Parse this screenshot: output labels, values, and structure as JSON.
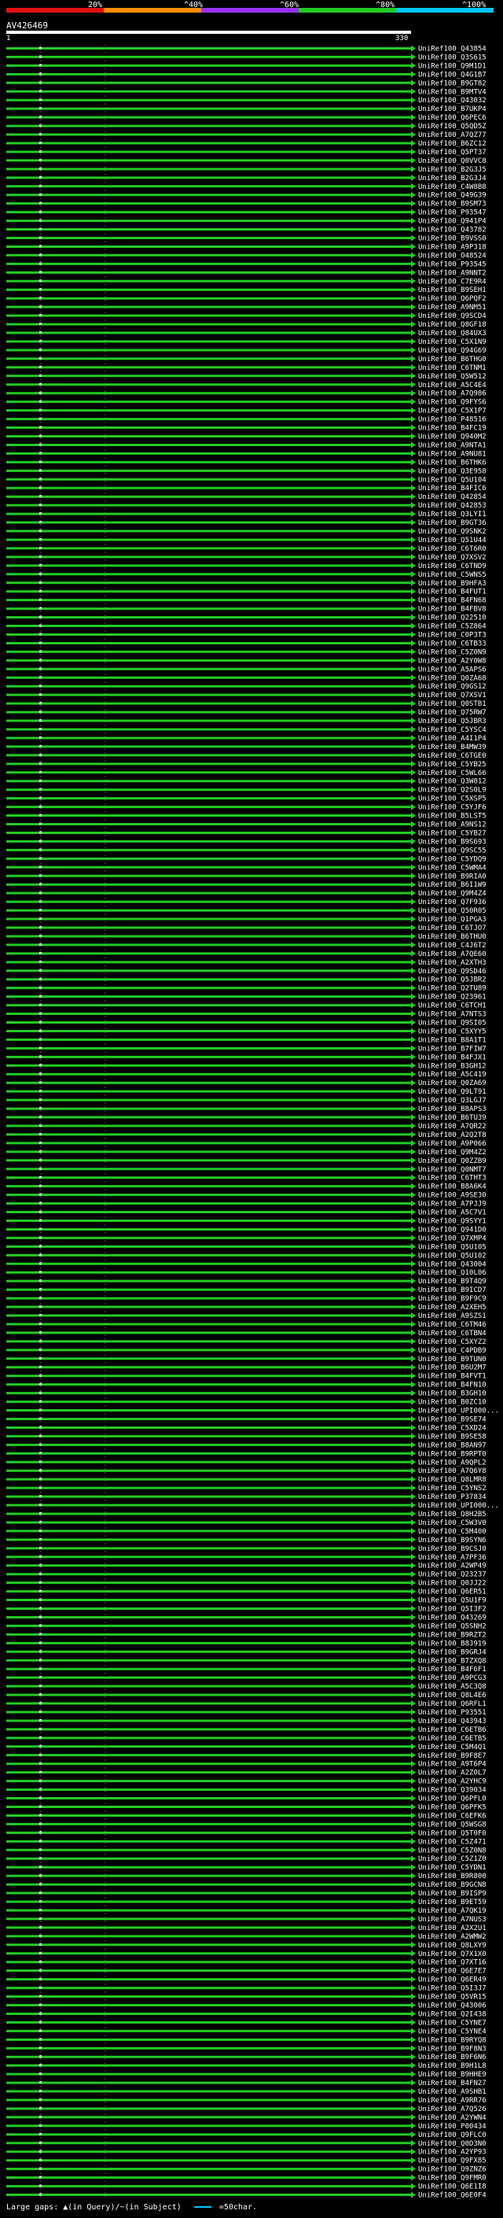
{
  "legend": {
    "ticks": [
      "20%",
      "^40%",
      "^60%",
      "^80%",
      "^100%"
    ],
    "colors": [
      "#e01010",
      "#ff8c00",
      "#9b30ff",
      "#22cc22",
      "#00c8ff"
    ]
  },
  "query": {
    "name": "AV426469",
    "start": "1",
    "end": "330"
  },
  "hits": [
    {
      "label": "UniRef100_Q43854",
      "color": "#22cc22"
    },
    {
      "label": "UniRef100_Q3S615",
      "color": "#22cc22"
    },
    {
      "label": "UniRef100_Q9M1D1",
      "color": "#22cc22"
    },
    {
      "label": "UniRef100_Q4G1B7",
      "color": "#22cc22"
    },
    {
      "label": "UniRef100_B9GT82",
      "color": "#22cc22"
    },
    {
      "label": "UniRef100_B9MTV4",
      "color": "#22cc22"
    },
    {
      "label": "UniRef100_Q43032",
      "color": "#22cc22"
    },
    {
      "label": "UniRef100_B7UKP4",
      "color": "#22cc22"
    },
    {
      "label": "UniRef100_Q6PEC6",
      "color": "#22cc22"
    },
    {
      "label": "UniRef100_Q5QD5Z",
      "color": "#22cc22"
    },
    {
      "label": "UniRef100_A7QZ77",
      "color": "#22cc22"
    },
    {
      "label": "UniRef100_B6ZC12",
      "color": "#22cc22"
    },
    {
      "label": "UniRef100_Q5PT37",
      "color": "#22cc22"
    },
    {
      "label": "UniRef100_Q0VVC8",
      "color": "#22cc22"
    },
    {
      "label": "UniRef100_B2G3J5",
      "color": "#22cc22"
    },
    {
      "label": "UniRef100_B2G3J4",
      "color": "#22cc22"
    },
    {
      "label": "UniRef100_C4W8B8",
      "color": "#22cc22"
    },
    {
      "label": "UniRef100_Q49G39",
      "color": "#22cc22"
    },
    {
      "label": "UniRef100_B9SM73",
      "color": "#22cc22"
    },
    {
      "label": "UniRef100_P93547",
      "color": "#22cc22"
    },
    {
      "label": "UniRef100_Q941P4",
      "color": "#22cc22"
    },
    {
      "label": "UniRef100_Q43782",
      "color": "#22cc22"
    },
    {
      "label": "UniRef100_B9VSS0",
      "color": "#22cc22"
    },
    {
      "label": "UniRef100_A9P318",
      "color": "#22cc22"
    },
    {
      "label": "UniRef100_O48524",
      "color": "#22cc22"
    },
    {
      "label": "UniRef100_P93545",
      "color": "#22cc22"
    },
    {
      "label": "UniRef100_A9NNT2",
      "color": "#22cc22"
    },
    {
      "label": "UniRef100_C7E9R4",
      "color": "#22cc22"
    },
    {
      "label": "UniRef100_B9SEH1",
      "color": "#22cc22"
    },
    {
      "label": "UniRef100_Q6PQF2",
      "color": "#22cc22"
    },
    {
      "label": "UniRef100_A9NM51",
      "color": "#22cc22"
    },
    {
      "label": "UniRef100_Q9SCD4",
      "color": "#22cc22"
    },
    {
      "label": "UniRef100_Q8GF18",
      "color": "#22cc22"
    },
    {
      "label": "UniRef100_Q84UX3",
      "color": "#22cc22"
    },
    {
      "label": "UniRef100_C5X1N9",
      "color": "#22cc22"
    },
    {
      "label": "UniRef100_Q94G69",
      "color": "#22cc22"
    },
    {
      "label": "UniRef100_B6THG0",
      "color": "#22cc22"
    },
    {
      "label": "UniRef100_C6TNM1",
      "color": "#22cc22"
    },
    {
      "label": "UniRef100_Q5W512",
      "color": "#22cc22"
    },
    {
      "label": "UniRef100_A5C4E4",
      "color": "#22cc22"
    },
    {
      "label": "UniRef100_A7Q986",
      "color": "#22cc22"
    },
    {
      "label": "UniRef100_Q9FYS6",
      "color": "#22cc22"
    },
    {
      "label": "UniRef100_C5X1P7",
      "color": "#22cc22"
    },
    {
      "label": "UniRef100_P48516",
      "color": "#22cc22"
    },
    {
      "label": "UniRef100_B4FC19",
      "color": "#22cc22"
    },
    {
      "label": "UniRef100_Q940M2",
      "color": "#22cc22"
    },
    {
      "label": "UniRef100_A9NTA1",
      "color": "#22cc22"
    },
    {
      "label": "UniRef100_A9NU81",
      "color": "#22cc22"
    },
    {
      "label": "UniRef100_B6THK6",
      "color": "#22cc22"
    },
    {
      "label": "UniRef100_Q3E958",
      "color": "#22cc22"
    },
    {
      "label": "UniRef100_Q5U104",
      "color": "#22cc22"
    },
    {
      "label": "UniRef100_B4FIC6",
      "color": "#22cc22"
    },
    {
      "label": "UniRef100_Q42854",
      "color": "#22cc22"
    },
    {
      "label": "UniRef100_Q42853",
      "color": "#22cc22"
    },
    {
      "label": "UniRef100_Q3LYI1",
      "color": "#22cc22"
    },
    {
      "label": "UniRef100_B9GT36",
      "color": "#22cc22"
    },
    {
      "label": "UniRef100_Q9SNK2",
      "color": "#22cc22"
    },
    {
      "label": "UniRef100_Q51U44",
      "color": "#22cc22"
    },
    {
      "label": "UniRef100_C6T6R0",
      "color": "#22cc22"
    },
    {
      "label": "UniRef100_Q7XSV2",
      "color": "#22cc22"
    },
    {
      "label": "UniRef100_C6TND9",
      "color": "#22cc22"
    },
    {
      "label": "UniRef100_C5WNS5",
      "color": "#22cc22"
    },
    {
      "label": "UniRef100_B9HFA3",
      "color": "#22cc22"
    },
    {
      "label": "UniRef100_B4FUT1",
      "color": "#22cc22"
    },
    {
      "label": "UniRef100_B4FN68",
      "color": "#22cc22"
    },
    {
      "label": "UniRef100_B4FBV8",
      "color": "#22cc22"
    },
    {
      "label": "UniRef100_Q22510",
      "color": "#22cc22"
    },
    {
      "label": "UniRef100_C5Z864",
      "color": "#22cc22"
    },
    {
      "label": "UniRef100_C0P3T3",
      "color": "#22cc22"
    },
    {
      "label": "UniRef100_C6TB33",
      "color": "#22cc22"
    },
    {
      "label": "UniRef100_C5Z0N9",
      "color": "#22cc22"
    },
    {
      "label": "UniRef100_A2Y0W8",
      "color": "#22cc22"
    },
    {
      "label": "UniRef100_A5APS6",
      "color": "#22cc22"
    },
    {
      "label": "UniRef100_Q0ZA68",
      "color": "#22cc22"
    },
    {
      "label": "UniRef100_Q9GS12",
      "color": "#22cc22"
    },
    {
      "label": "UniRef100_Q7XSV1",
      "color": "#22cc22"
    },
    {
      "label": "UniRef100_Q0STB1",
      "color": "#22cc22"
    },
    {
      "label": "UniRef100_Q75RW7",
      "color": "#22cc22"
    },
    {
      "label": "UniRef100_Q5JBR3",
      "color": "#22cc22"
    },
    {
      "label": "UniRef100_C5YSC4",
      "color": "#22cc22"
    },
    {
      "label": "UniRef100_A4I1P4",
      "color": "#22cc22"
    },
    {
      "label": "UniRef100_B4MW39",
      "color": "#22cc22"
    },
    {
      "label": "UniRef100_C6TGE0",
      "color": "#22cc22"
    },
    {
      "label": "UniRef100_C5YB25",
      "color": "#22cc22"
    },
    {
      "label": "UniRef100_C5WL66",
      "color": "#22cc22"
    },
    {
      "label": "UniRef100_Q3W812",
      "color": "#22cc22"
    },
    {
      "label": "UniRef100_Q2S0L9",
      "color": "#22cc22"
    },
    {
      "label": "UniRef100_C5XSP5",
      "color": "#22cc22"
    },
    {
      "label": "UniRef100_C5YJF6",
      "color": "#22cc22"
    },
    {
      "label": "UniRef100_B5LST5",
      "color": "#22cc22"
    },
    {
      "label": "UniRef100_A9NS12",
      "color": "#22cc22"
    },
    {
      "label": "UniRef100_C5YB27",
      "color": "#22cc22"
    },
    {
      "label": "UniRef100_B9S693",
      "color": "#22cc22"
    },
    {
      "label": "UniRef100_Q9SC55",
      "color": "#22cc22"
    },
    {
      "label": "UniRef100_C5YDQ9",
      "color": "#22cc22"
    },
    {
      "label": "UniRef100_C5WMA4",
      "color": "#22cc22"
    },
    {
      "label": "UniRef100_B9RIA0",
      "color": "#22cc22"
    },
    {
      "label": "UniRef100_B6I1W9",
      "color": "#22cc22"
    },
    {
      "label": "UniRef100_Q9M4Z4",
      "color": "#22cc22"
    },
    {
      "label": "UniRef100_Q7F936",
      "color": "#22cc22"
    },
    {
      "label": "UniRef100_Q50R05",
      "color": "#22cc22"
    },
    {
      "label": "UniRef100_Q1PGA3",
      "color": "#22cc22"
    },
    {
      "label": "UniRef100_C6TJO7",
      "color": "#22cc22"
    },
    {
      "label": "UniRef100_B6THU0",
      "color": "#22cc22"
    },
    {
      "label": "UniRef100_C4J6T2",
      "color": "#22cc22"
    },
    {
      "label": "UniRef100_A7QE60",
      "color": "#22cc22"
    },
    {
      "label": "UniRef100_A2XTH3",
      "color": "#22cc22"
    },
    {
      "label": "UniRef100_Q9SD46",
      "color": "#22cc22"
    },
    {
      "label": "UniRef100_Q5JBR2",
      "color": "#22cc22"
    },
    {
      "label": "UniRef100_Q2TU89",
      "color": "#22cc22"
    },
    {
      "label": "UniRef100_Q23961",
      "color": "#22cc22"
    },
    {
      "label": "UniRef100_C6TCH1",
      "color": "#22cc22"
    },
    {
      "label": "UniRef100_A7NTS3",
      "color": "#22cc22"
    },
    {
      "label": "UniRef100_Q9SI05",
      "color": "#22cc22"
    },
    {
      "label": "UniRef100_C5XYY5",
      "color": "#22cc22"
    },
    {
      "label": "UniRef100_B8A1T1",
      "color": "#22cc22"
    },
    {
      "label": "UniRef100_B7FIW7",
      "color": "#22cc22"
    },
    {
      "label": "UniRef100_B4FJX1",
      "color": "#22cc22"
    },
    {
      "label": "UniRef100_B3GH12",
      "color": "#22cc22"
    },
    {
      "label": "UniRef100_A5C419",
      "color": "#22cc22"
    },
    {
      "label": "UniRef100_Q0ZA69",
      "color": "#22cc22"
    },
    {
      "label": "UniRef100_Q9LT91",
      "color": "#22cc22"
    },
    {
      "label": "UniRef100_Q3LGJ7",
      "color": "#22cc22"
    },
    {
      "label": "UniRef100_B8APS3",
      "color": "#22cc22"
    },
    {
      "label": "UniRef100_B6TU39",
      "color": "#22cc22"
    },
    {
      "label": "UniRef100_A7QR22",
      "color": "#22cc22"
    },
    {
      "label": "UniRef100_A2Q2T8",
      "color": "#22cc22"
    },
    {
      "label": "UniRef100_A9P066",
      "color": "#22cc22"
    },
    {
      "label": "UniRef100_Q9M4Z2",
      "color": "#22cc22"
    },
    {
      "label": "UniRef100_Q0ZZB9",
      "color": "#22cc22"
    },
    {
      "label": "UniRef100_Q0NMT7",
      "color": "#22cc22"
    },
    {
      "label": "UniRef100_C6THT3",
      "color": "#22cc22"
    },
    {
      "label": "UniRef100_B8A6K4",
      "color": "#22cc22"
    },
    {
      "label": "UniRef100_A9SE30",
      "color": "#22cc22"
    },
    {
      "label": "UniRef100_A7PJJ9",
      "color": "#22cc22"
    },
    {
      "label": "UniRef100_A5C7V1",
      "color": "#22cc22"
    },
    {
      "label": "UniRef100_Q9SYY1",
      "color": "#22cc22"
    },
    {
      "label": "UniRef100_Q941D0",
      "color": "#22cc22"
    },
    {
      "label": "UniRef100_Q7XMP4",
      "color": "#22cc22"
    },
    {
      "label": "UniRef100_Q5U105",
      "color": "#22cc22"
    },
    {
      "label": "UniRef100_Q5U102",
      "color": "#22cc22"
    },
    {
      "label": "UniRef100_Q43004",
      "color": "#22cc22"
    },
    {
      "label": "UniRef100_Q10L06",
      "color": "#22cc22"
    },
    {
      "label": "UniRef100_B9T4Q9",
      "color": "#22cc22"
    },
    {
      "label": "UniRef100_B9ICD7",
      "color": "#22cc22"
    },
    {
      "label": "UniRef100_B9F9C9",
      "color": "#22cc22"
    },
    {
      "label": "UniRef100_A2XEH5",
      "color": "#22cc22"
    },
    {
      "label": "UniRef100_A9SZS1",
      "color": "#22cc22"
    },
    {
      "label": "UniRef100_C6TM46",
      "color": "#22cc22"
    },
    {
      "label": "UniRef100_C6TBN4",
      "color": "#22cc22"
    },
    {
      "label": "UniRef100_C5XYZ2",
      "color": "#22cc22"
    },
    {
      "label": "UniRef100_C4PDB9",
      "color": "#22cc22"
    },
    {
      "label": "UniRef100_B9TUN0",
      "color": "#22cc22"
    },
    {
      "label": "UniRef100_B6U2M7",
      "color": "#22cc22"
    },
    {
      "label": "UniRef100_B4FVT1",
      "color": "#22cc22"
    },
    {
      "label": "UniRef100_B4FN10",
      "color": "#22cc22"
    },
    {
      "label": "UniRef100_B3GH10",
      "color": "#22cc22"
    },
    {
      "label": "UniRef100_B0ZC10",
      "color": "#22cc22"
    },
    {
      "label": "UniRef100_UPI000...",
      "color": "#22cc22"
    },
    {
      "label": "UniRef100_B9SE74",
      "color": "#22cc22"
    },
    {
      "label": "UniRef100_C5XD24",
      "color": "#22cc22"
    },
    {
      "label": "UniRef100_B9SE58",
      "color": "#22cc22"
    },
    {
      "label": "UniRef100_B8AN97",
      "color": "#22cc22"
    },
    {
      "label": "UniRef100_B9RPT0",
      "color": "#22cc22"
    },
    {
      "label": "UniRef100_A9QPL2",
      "color": "#22cc22"
    },
    {
      "label": "UniRef100_A7Q6Y8",
      "color": "#22cc22"
    },
    {
      "label": "UniRef100_Q8LMR8",
      "color": "#22cc22"
    },
    {
      "label": "UniRef100_C5YNS2",
      "color": "#22cc22"
    },
    {
      "label": "UniRef100_P37834",
      "color": "#22cc22"
    },
    {
      "label": "UniRef100_UPI000...",
      "color": "#22cc22"
    },
    {
      "label": "UniRef100_Q8H2B5",
      "color": "#22cc22"
    },
    {
      "label": "UniRef100_C5W3V0",
      "color": "#22cc22"
    },
    {
      "label": "UniRef100_C5M400",
      "color": "#22cc22"
    },
    {
      "label": "UniRef100_B9SYN6",
      "color": "#22cc22"
    },
    {
      "label": "UniRef100_B9CSJ0",
      "color": "#22cc22"
    },
    {
      "label": "UniRef100_A7PF36",
      "color": "#22cc22"
    },
    {
      "label": "UniRef100_A2WP49",
      "color": "#22cc22"
    },
    {
      "label": "UniRef100_Q23237",
      "color": "#22cc22"
    },
    {
      "label": "UniRef100_Q0JJ22",
      "color": "#22cc22"
    },
    {
      "label": "UniRef100_Q6ER51",
      "color": "#22cc22"
    },
    {
      "label": "UniRef100_Q5U1F9",
      "color": "#22cc22"
    },
    {
      "label": "UniRef100_Q5I3F2",
      "color": "#22cc22"
    },
    {
      "label": "UniRef100_Q43269",
      "color": "#22cc22"
    },
    {
      "label": "UniRef100_Q5SNH2",
      "color": "#22cc22"
    },
    {
      "label": "UniRef100_B9RZT2",
      "color": "#22cc22"
    },
    {
      "label": "UniRef100_B8J919",
      "color": "#22cc22"
    },
    {
      "label": "UniRef100_B9GRJ4",
      "color": "#22cc22"
    },
    {
      "label": "UniRef100_B7ZXQ8",
      "color": "#22cc22"
    },
    {
      "label": "UniRef100_B4F6F1",
      "color": "#22cc22"
    },
    {
      "label": "UniRef100_A9PCG3",
      "color": "#22cc22"
    },
    {
      "label": "UniRef100_A5C3Q8",
      "color": "#22cc22"
    },
    {
      "label": "UniRef100_Q8L4E6",
      "color": "#22cc22"
    },
    {
      "label": "UniRef100_Q6RFL1",
      "color": "#22cc22"
    },
    {
      "label": "UniRef100_P93551",
      "color": "#22cc22"
    },
    {
      "label": "UniRef100_Q43943",
      "color": "#22cc22"
    },
    {
      "label": "UniRef100_C6ETB6",
      "color": "#22cc22"
    },
    {
      "label": "UniRef100_C6ETB5",
      "color": "#22cc22"
    },
    {
      "label": "UniRef100_C5M4Q1",
      "color": "#22cc22"
    },
    {
      "label": "UniRef100_B9F8E7",
      "color": "#22cc22"
    },
    {
      "label": "UniRef100_A9T6P4",
      "color": "#22cc22"
    },
    {
      "label": "UniRef100_A2Z0L7",
      "color": "#22cc22"
    },
    {
      "label": "UniRef100_A2YHC9",
      "color": "#22cc22"
    },
    {
      "label": "UniRef100_Q39034",
      "color": "#22cc22"
    },
    {
      "label": "UniRef100_Q6PFL0",
      "color": "#22cc22"
    },
    {
      "label": "UniRef100_Q6PFK5",
      "color": "#22cc22"
    },
    {
      "label": "UniRef100_C6EFK6",
      "color": "#22cc22"
    },
    {
      "label": "UniRef100_Q5WSG8",
      "color": "#22cc22"
    },
    {
      "label": "UniRef100_Q5T0F0",
      "color": "#22cc22"
    },
    {
      "label": "UniRef100_C5Z471",
      "color": "#22cc22"
    },
    {
      "label": "UniRef100_C5Z0N8",
      "color": "#22cc22"
    },
    {
      "label": "UniRef100_C5Z1Z0",
      "color": "#22cc22"
    },
    {
      "label": "UniRef100_C5YDN1",
      "color": "#22cc22"
    },
    {
      "label": "UniRef100_B9R800",
      "color": "#22cc22"
    },
    {
      "label": "UniRef100_B9GCN8",
      "color": "#22cc22"
    },
    {
      "label": "UniRef100_B9ISP9",
      "color": "#22cc22"
    },
    {
      "label": "UniRef100_B9ET59",
      "color": "#22cc22"
    },
    {
      "label": "UniRef100_A7QK19",
      "color": "#22cc22"
    },
    {
      "label": "UniRef100_A7NUS3",
      "color": "#22cc22"
    },
    {
      "label": "UniRef100_A2X2U1",
      "color": "#22cc22"
    },
    {
      "label": "UniRef100_A2WMW2",
      "color": "#22cc22"
    },
    {
      "label": "UniRef100_Q8LXY9",
      "color": "#22cc22"
    },
    {
      "label": "UniRef100_Q7X1X0",
      "color": "#22cc22"
    },
    {
      "label": "UniRef100_Q7XT16",
      "color": "#22cc22"
    },
    {
      "label": "UniRef100_Q6E7E7",
      "color": "#22cc22"
    },
    {
      "label": "UniRef100_Q6ER49",
      "color": "#22cc22"
    },
    {
      "label": "UniRef100_Q5I3J7",
      "color": "#22cc22"
    },
    {
      "label": "UniRef100_Q5VR15",
      "color": "#22cc22"
    },
    {
      "label": "UniRef100_Q43006",
      "color": "#22cc22"
    },
    {
      "label": "UniRef100_Q2I438",
      "color": "#22cc22"
    },
    {
      "label": "UniRef100_C5YNE7",
      "color": "#22cc22"
    },
    {
      "label": "UniRef100_C5YNE4",
      "color": "#22cc22"
    },
    {
      "label": "UniRef100_B9RYQ8",
      "color": "#22cc22"
    },
    {
      "label": "UniRef100_B9F8N3",
      "color": "#22cc22"
    },
    {
      "label": "UniRef100_B9F6N6",
      "color": "#22cc22"
    },
    {
      "label": "UniRef100_B9H1L8",
      "color": "#22cc22"
    },
    {
      "label": "UniRef100_B9HHE9",
      "color": "#22cc22"
    },
    {
      "label": "UniRef100_B4FN27",
      "color": "#22cc22"
    },
    {
      "label": "UniRef100_A9SHB1",
      "color": "#22cc22"
    },
    {
      "label": "UniRef100_A9RR76",
      "color": "#22cc22"
    },
    {
      "label": "UniRef100_A7Q526",
      "color": "#22cc22"
    },
    {
      "label": "UniRef100_A2YWN4",
      "color": "#22cc22"
    },
    {
      "label": "UniRef100_P00434",
      "color": "#22cc22"
    },
    {
      "label": "UniRef100_Q9FLC0",
      "color": "#22cc22"
    },
    {
      "label": "UniRef100_Q0D3N0",
      "color": "#22cc22"
    },
    {
      "label": "UniRef100_A2YP93",
      "color": "#22cc22"
    },
    {
      "label": "UniRef100_Q9FX85",
      "color": "#22cc22"
    },
    {
      "label": "UniRef100_Q9ZNZ6",
      "color": "#22cc22"
    },
    {
      "label": "UniRef100_Q9FMR0",
      "color": "#22cc22"
    },
    {
      "label": "UniRef100_Q6E1I8",
      "color": "#22cc22"
    },
    {
      "label": "UniRef100_Q6E0F4",
      "color": "#22cc22"
    }
  ],
  "footer": {
    "text": "Large gaps: ▲(in Query)/~(in Subject)",
    "scale": "=50char."
  }
}
